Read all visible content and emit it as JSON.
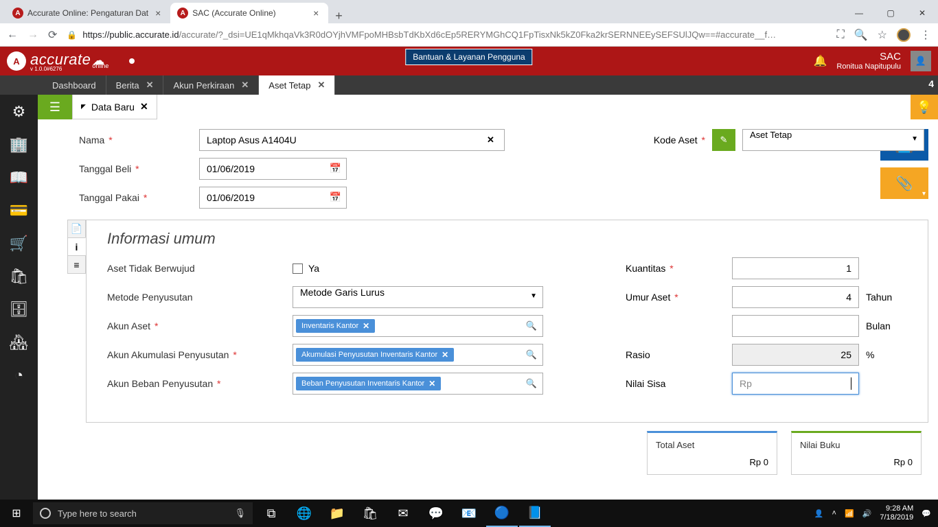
{
  "browser": {
    "tabs": [
      {
        "title": "Accurate Online: Pengaturan Dat"
      },
      {
        "title": "SAC (Accurate Online)"
      }
    ],
    "url_host": "https://public.accurate.id",
    "url_path": "/accurate/?_dsi=UE1qMkhqaVk3R0dOYjhVMFpoMHBsbTdKbXd6cEp5RERYMGhCQ1FpTisxNk5kZ0Fka2krSERNNEEySEFSUlJQw==#accurate__f…"
  },
  "app": {
    "help_callout": "Bantuan & Layanan Pengguna",
    "company": "SAC",
    "user": "Ronitua Napitupulu",
    "tab_count": "4",
    "tabs": [
      {
        "label": "Dashboard",
        "closable": false
      },
      {
        "label": "Berita",
        "closable": true
      },
      {
        "label": "Akun Perkiraan",
        "closable": true
      },
      {
        "label": "Aset Tetap",
        "closable": true,
        "active": true
      }
    ],
    "subtab": "Data Baru"
  },
  "form": {
    "nama_label": "Nama",
    "nama_value": "Laptop Asus A1404U",
    "tgl_beli_label": "Tanggal Beli",
    "tgl_beli_value": "01/06/2019",
    "tgl_pakai_label": "Tanggal Pakai",
    "tgl_pakai_value": "01/06/2019",
    "kode_label": "Kode Aset",
    "kode_value": "Aset Tetap"
  },
  "info": {
    "panel_title": "Informasi umum",
    "intangible_label": "Aset Tidak Berwujud",
    "intangible_cb": "Ya",
    "metode_label": "Metode Penyusutan",
    "metode_value": "Metode Garis Lurus",
    "akun_aset_label": "Akun Aset",
    "akun_aset_tag": "Inventaris Kantor",
    "akun_akum_label": "Akun Akumulasi Penyusutan",
    "akun_akum_tag": "Akumulasi Penyusutan Inventaris Kantor",
    "akun_beban_label": "Akun Beban Penyusutan",
    "akun_beban_tag": "Beban Penyusutan Inventaris Kantor",
    "kuantitas_label": "Kuantitas",
    "kuantitas_value": "1",
    "umur_label": "Umur Aset",
    "umur_tahun_value": "4",
    "tahun": "Tahun",
    "bulan": "Bulan",
    "rasio_label": "Rasio",
    "rasio_value": "25",
    "persen": "%",
    "nilai_sisa_label": "Nilai Sisa",
    "nilai_sisa_prefix": "Rp"
  },
  "totals": {
    "total_aset_label": "Total Aset",
    "total_aset_value": "Rp 0",
    "nilai_buku_label": "Nilai Buku",
    "nilai_buku_value": "Rp 0"
  },
  "taskbar": {
    "search_placeholder": "Type here to search",
    "time": "9:28 AM",
    "date": "7/18/2019"
  }
}
